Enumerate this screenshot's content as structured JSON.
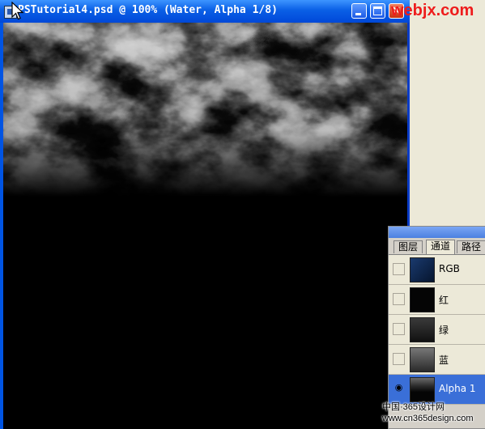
{
  "window": {
    "title": "PSTutorial4.psd @ 100% (Water, Alpha 1/8)",
    "close_glyph": "×"
  },
  "icons": {
    "document": "photoshop-document-icon",
    "cursor": "arrow-cursor-icon",
    "visibility": "eye-icon"
  },
  "palette": {
    "tabs": [
      "图层",
      "通道",
      "路径"
    ],
    "active_tab": "通道",
    "channels": [
      {
        "label": "RGB",
        "visible": false,
        "selected": false,
        "thumb": "#0e2a52"
      },
      {
        "label": "红",
        "visible": false,
        "selected": false,
        "thumb": "#050505"
      },
      {
        "label": "绿",
        "visible": false,
        "selected": false,
        "thumb": "#2a2a2a"
      },
      {
        "label": "蓝",
        "visible": false,
        "selected": false,
        "thumb": "#5a5a5a"
      },
      {
        "label": "Alpha 1",
        "visible": true,
        "selected": true,
        "thumb": "#1a1a1a"
      }
    ],
    "eye_glyph": "◉"
  },
  "watermarks": {
    "top": "webjx.com",
    "bottom_line1": "中国·365设计网",
    "bottom_line2": "www.cn365design.com"
  },
  "colors": {
    "title_blue": "#0054e3",
    "selection_blue": "#3a6fd8",
    "watermark_red": "#ee1c1c"
  }
}
